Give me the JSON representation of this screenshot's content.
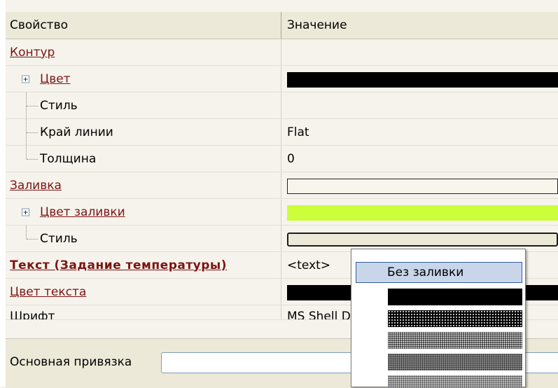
{
  "header": {
    "property": "Свойство",
    "value": "Значение"
  },
  "rows": [
    {
      "name": "Контур",
      "kind": "category"
    },
    {
      "name": "Цвет",
      "kind": "expandable",
      "value_swatch": "#000000"
    },
    {
      "name": "Стиль",
      "kind": "child",
      "value": ""
    },
    {
      "name": "Край линии",
      "kind": "child",
      "value": "Flat"
    },
    {
      "name": "Толщина",
      "kind": "child",
      "value": "0"
    },
    {
      "name": "Заливка",
      "kind": "category"
    },
    {
      "name": "Цвет заливки",
      "kind": "expandable",
      "value_swatch": "#ccff3a"
    },
    {
      "name": "Стиль",
      "kind": "child"
    },
    {
      "name": "Текст (Задание  температуры)",
      "kind": "category-bold",
      "value": "<text>"
    },
    {
      "name": "Цвет текста",
      "kind": "category",
      "value_swatch": "#000000"
    },
    {
      "name": "Шрифт",
      "kind": "child-plain",
      "value": "MS Shell Dlg"
    }
  ],
  "dropdown": {
    "selected": "Без заливки",
    "patterns": [
      "solid",
      "dense-dots",
      "medium-dots",
      "light-dots",
      "lighter-dots"
    ]
  },
  "footer": {
    "label": "Основная привязка",
    "value": ""
  },
  "colors": {
    "category_text": "#7b1414",
    "selection": "#c9d6ea",
    "fill_green": "#ccff3a"
  }
}
